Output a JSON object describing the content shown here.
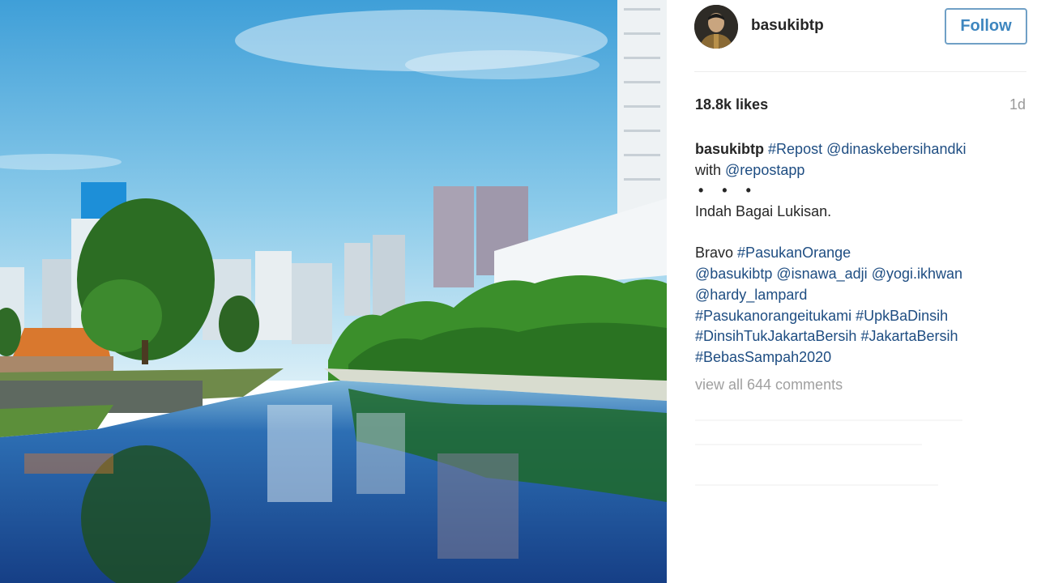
{
  "post": {
    "username": "basukibtp",
    "follow_label": "Follow",
    "likes": "18.8k likes",
    "time_ago": "1d",
    "caption": {
      "line1_user": "basukibtp",
      "line1_tag": "#Repost",
      "line1_mention": "@dinaskebersihandki",
      "line2_text": "with",
      "line2_mention": "@repostapp",
      "dots": "• • •",
      "line4_text": "Indah Bagai Lukisan.",
      "line6_text": "Bravo",
      "line6_tag": "#PasukanOrange",
      "line7_m1": "@basukibtp",
      "line7_m2": "@isnawa_adji",
      "line7_m3": "@yogi.ikhwan",
      "line8_m1": "@hardy_lampard",
      "line9_t1": "#Pasukanorangeitukami",
      "line9_t2": "#UpkBaDinsih",
      "line10_t1": "#DinsihTukJakartaBersih",
      "line10_t2": "#JakartaBersih",
      "line11_t1": "#BebasSampah2020"
    },
    "view_comments": "view all 644 comments"
  },
  "image": {
    "subject": "river-cityscape-photo",
    "colors": {
      "sky_top": "#4fa9dc",
      "sky_bottom": "#cde9f5",
      "water": "#1f5fa8",
      "foliage": "#2f7d2a"
    }
  },
  "accent": {
    "link": "#1e4d82",
    "follow_border": "#70a0c6",
    "follow_text": "#3e86bf",
    "muted": "#9a9a9a"
  }
}
